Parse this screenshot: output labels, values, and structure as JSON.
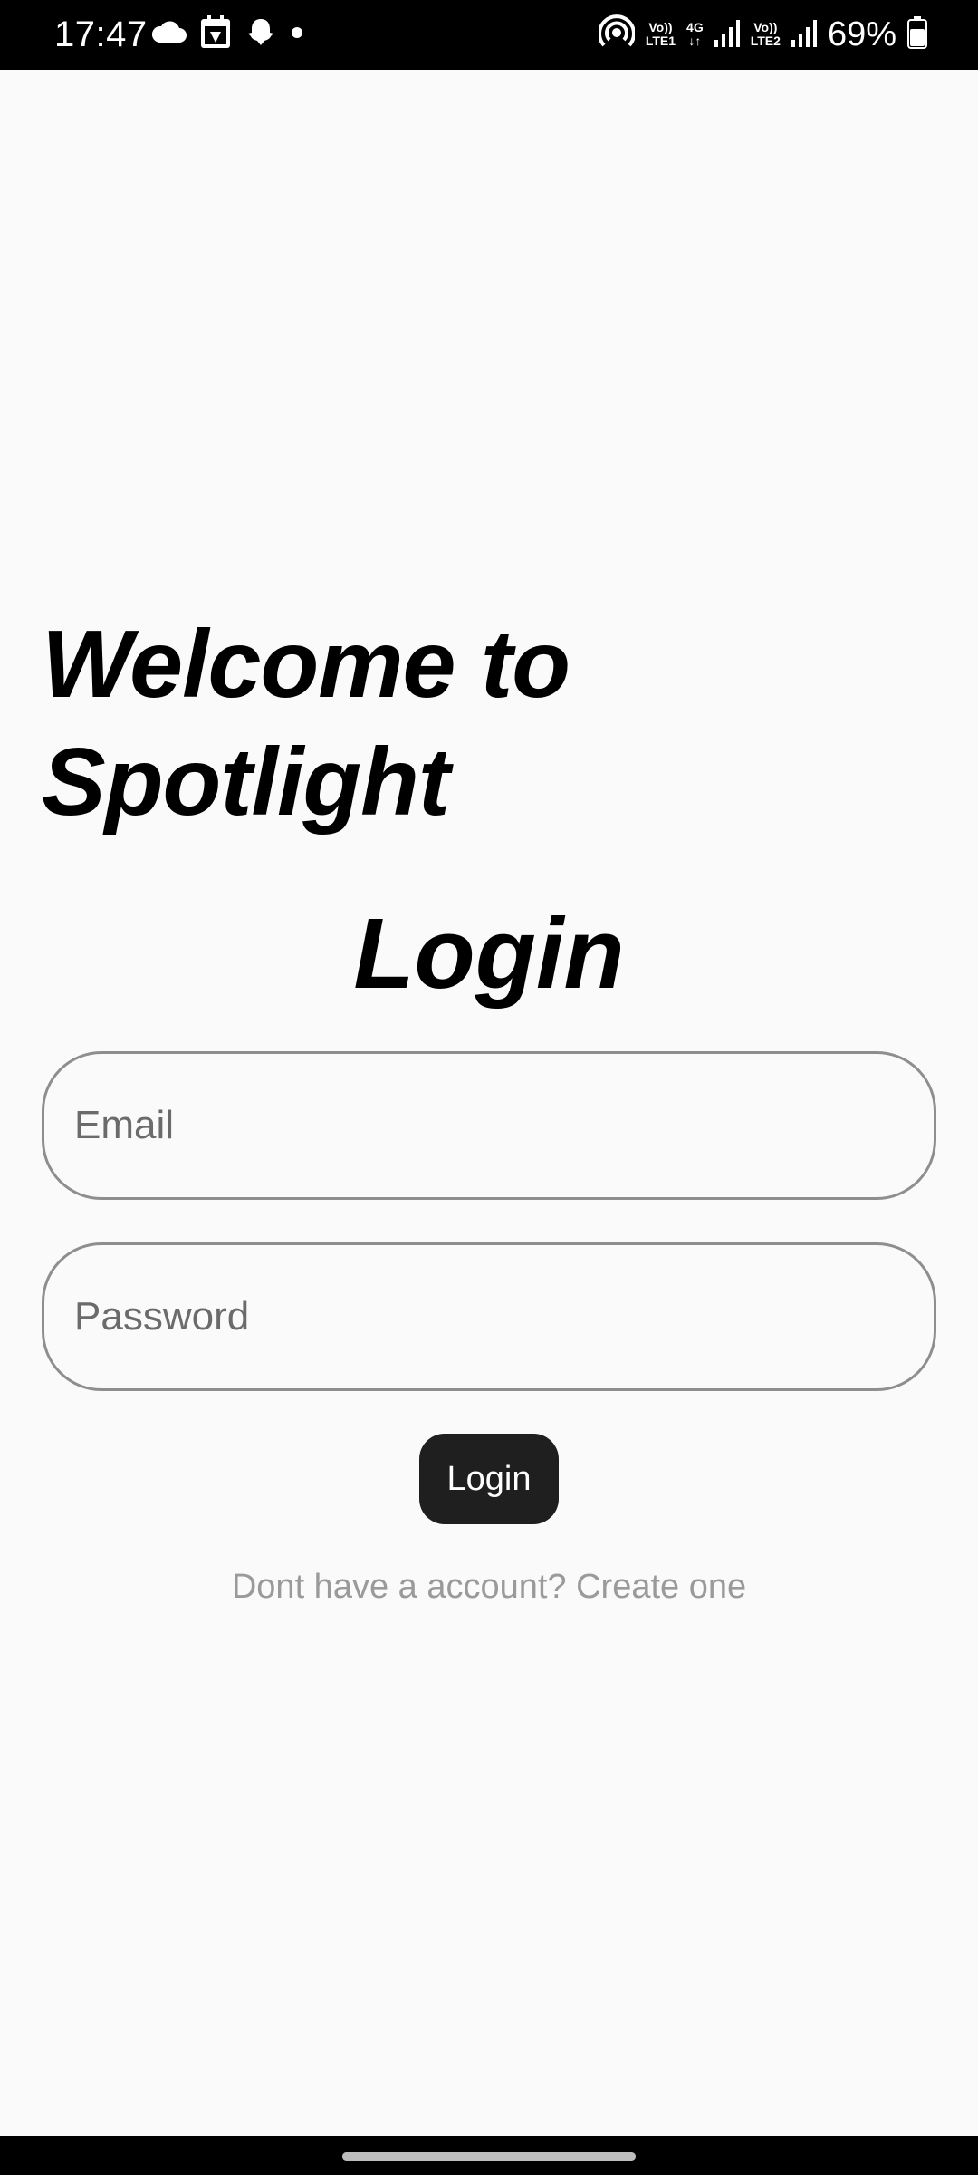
{
  "status_bar": {
    "time": "17:47",
    "left_icons": [
      "cloud-icon",
      "calendar-icon",
      "snapchat-icon",
      "dot-icon"
    ],
    "sim1_top": "Vo))",
    "sim1_bottom": "LTE1",
    "net_top": "4G",
    "net_bottom": "↓↑",
    "sim2_top": "Vo))",
    "sim2_bottom": "LTE2",
    "battery_percent": "69%"
  },
  "main": {
    "welcome_text": "Welcome to Spotlight",
    "login_title": "Login",
    "email_placeholder": "Email",
    "password_placeholder": "Password",
    "login_button_label": "Login",
    "signup_text": "Dont have a account? Create one"
  },
  "colors": {
    "background": "#fafafa",
    "button": "#1f1f1f",
    "field_border": "#8e8e8e",
    "link_text": "#9a9a9a"
  }
}
